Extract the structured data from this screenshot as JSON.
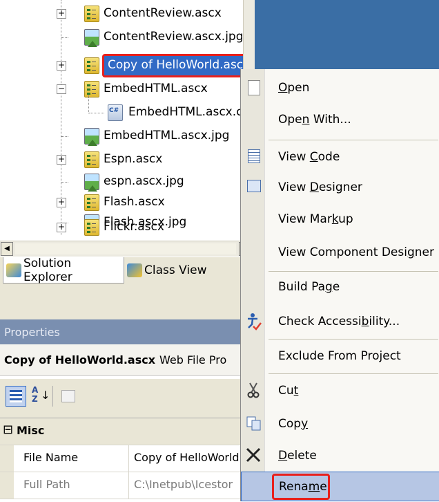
{
  "tree": {
    "items": [
      {
        "label": "ContentReview.ascx",
        "type": "ascx",
        "expander": "+"
      },
      {
        "label": "ContentReview.ascx.jpg",
        "type": "jpg",
        "expander": ""
      },
      {
        "label": "Copy of HelloWorld.ascx",
        "type": "ascx",
        "expander": "+"
      },
      {
        "label": "EmbedHTML.ascx",
        "type": "ascx",
        "expander": "−"
      },
      {
        "label": "EmbedHTML.ascx.cs",
        "type": "cs",
        "expander": ""
      },
      {
        "label": "EmbedHTML.ascx.jpg",
        "type": "jpg",
        "expander": ""
      },
      {
        "label": "Espn.ascx",
        "type": "ascx",
        "expander": "+"
      },
      {
        "label": "espn.ascx.jpg",
        "type": "jpg",
        "expander": ""
      },
      {
        "label": "Flash.ascx",
        "type": "ascx",
        "expander": "+"
      },
      {
        "label": "Flash.ascx.jpg",
        "type": "jpg",
        "expander": ""
      },
      {
        "label": "Flickr.ascx",
        "type": "ascx",
        "expander": "+"
      }
    ]
  },
  "tabs": {
    "solution_explorer": "Solution Explorer",
    "class_view": "Class View"
  },
  "properties": {
    "title": "Properties",
    "object_name": "Copy of HelloWorld.ascx",
    "object_type": "Web File Pro",
    "sort_alpha_label": "A Z",
    "category": "Misc",
    "category_toggle": "⊟",
    "rows": [
      {
        "name": "File Name",
        "value": "Copy of HelloWorld"
      },
      {
        "name": "Full Path",
        "value": "C:\\Inetpub\\Icestor"
      }
    ]
  },
  "context_menu": {
    "items": [
      {
        "pre": "",
        "u": "O",
        "post": "pen",
        "icon": "open-icon"
      },
      {
        "pre": "Ope",
        "u": "n",
        "post": " With...",
        "icon": ""
      },
      {
        "pre": "View ",
        "u": "C",
        "post": "ode",
        "icon": "view-code-icon"
      },
      {
        "pre": "View ",
        "u": "D",
        "post": "esigner",
        "icon": "view-designer-icon"
      },
      {
        "pre": "View Mar",
        "u": "k",
        "post": "up",
        "icon": ""
      },
      {
        "pre": "View Component Desi",
        "u": "g",
        "post": "ner",
        "icon": ""
      },
      {
        "pre": "Build Pa",
        "u": "g",
        "post": "e",
        "icon": ""
      },
      {
        "pre": "Check Accessi",
        "u": "b",
        "post": "ility...",
        "icon": "accessibility-icon"
      },
      {
        "pre": "Exclude From Pro",
        "u": "j",
        "post": "ect",
        "icon": ""
      },
      {
        "pre": "Cu",
        "u": "t",
        "post": "",
        "icon": "cut-icon"
      },
      {
        "pre": "Cop",
        "u": "y",
        "post": "",
        "icon": "copy-icon"
      },
      {
        "pre": "",
        "u": "D",
        "post": "elete",
        "icon": "delete-icon"
      },
      {
        "pre": "Rena",
        "u": "m",
        "post": "e",
        "icon": ""
      }
    ]
  },
  "colors": {
    "highlight_red": "#e8201c",
    "selection_blue": "#316ac5",
    "menu_hover": "#b6c6e4"
  }
}
